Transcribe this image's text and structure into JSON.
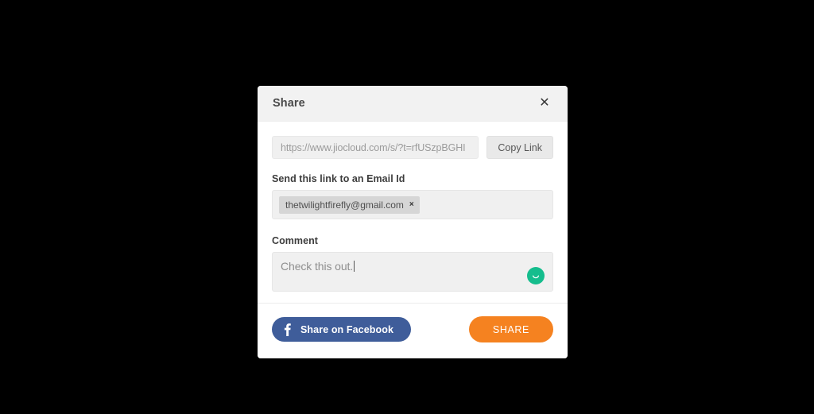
{
  "dialog": {
    "title": "Share",
    "close_icon": "close-icon",
    "link": {
      "value": "https://www.jiocloud.com/s/?t=rfUSzpBGHI",
      "copy_button_label": "Copy Link"
    },
    "email": {
      "label": "Send this link to an Email Id",
      "placeholder": "",
      "chips": [
        {
          "address": "thetwilightfirefly@gmail.com",
          "remove_icon": "×"
        }
      ]
    },
    "comment": {
      "label": "Comment",
      "value": "Check this out.",
      "placeholder": "Comment",
      "emoji_icon": "smiley-icon",
      "emoji_color": "#15bd8d"
    },
    "footer": {
      "facebook_label": "Share on Facebook",
      "facebook_icon": "facebook-f-icon",
      "facebook_color": "#3f5d9a",
      "share_label": "SHARE",
      "share_color": "#f58220"
    }
  },
  "theme": {
    "backdrop": "#000000",
    "header_bg": "#f2f2f2",
    "field_bg": "#f0f0f0",
    "chip_bg": "#d6d6d6"
  }
}
